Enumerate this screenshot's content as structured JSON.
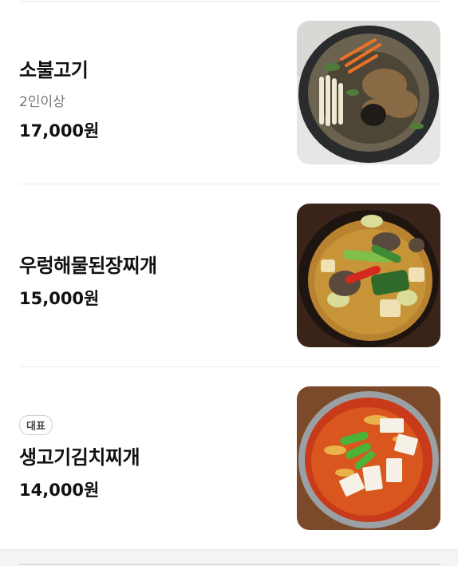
{
  "menu": {
    "items": [
      {
        "name": "소불고기",
        "description": "2인이상",
        "price": "17,000원",
        "badge": "",
        "image": "bulgogi-hotpot-photo"
      },
      {
        "name": "우렁해물된장찌개",
        "description": "",
        "price": "15,000원",
        "badge": "",
        "image": "doenjang-jjigae-photo"
      },
      {
        "name": "생고기김치찌개",
        "description": "",
        "price": "14,000원",
        "badge": "대표",
        "image": "kimchi-jjigae-photo"
      }
    ]
  }
}
